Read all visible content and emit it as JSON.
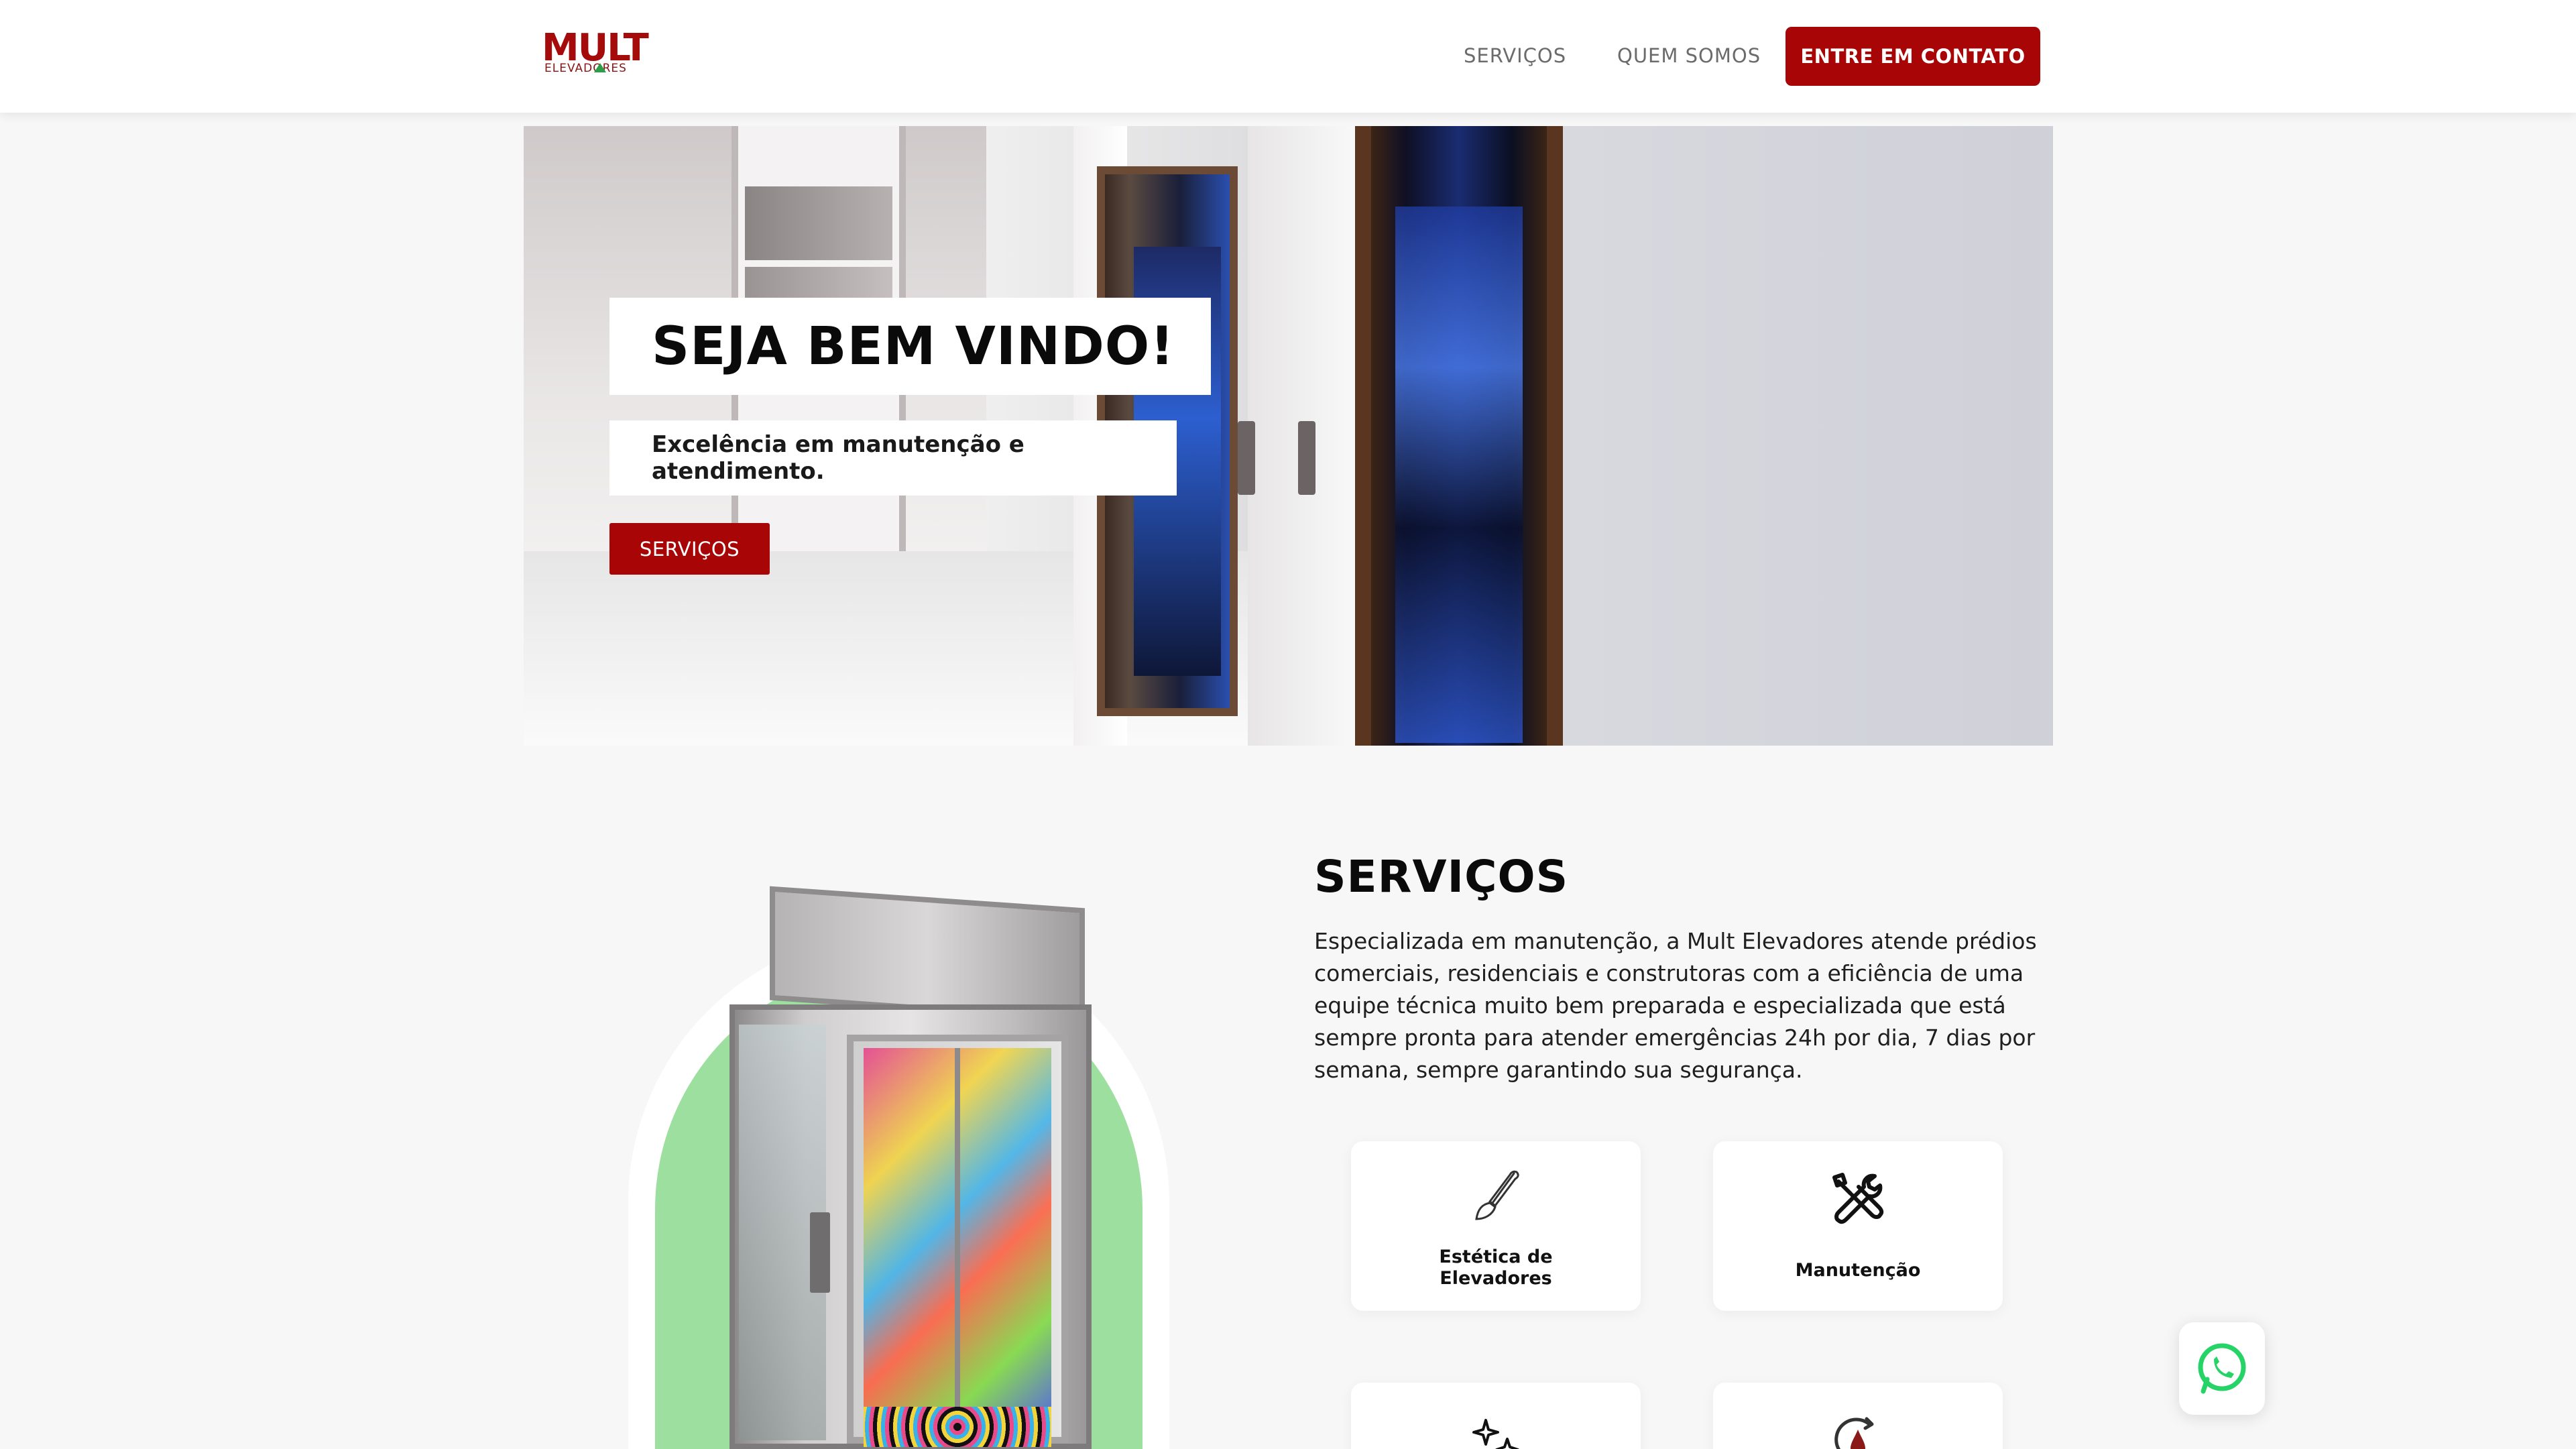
{
  "header": {
    "logo_text": "MULT",
    "logo_subtext": "ELEVADORES",
    "nav": {
      "services": "SERVIÇOS",
      "about": "QUEM SOMOS"
    },
    "cta_label": "ENTRE EM CONTATO"
  },
  "hero": {
    "title": "SEJA BEM VINDO!",
    "subtitle": "Excelência em manutenção e atendimento.",
    "button_label": "SERVIÇOS"
  },
  "services": {
    "title": "SERVIÇOS",
    "description": "Especializada em manutenção, a Mult Elevadores atende prédios comerciais, residenciais e construtoras com a eficiência de uma equipe técnica muito bem preparada e especializada que está sempre pronta para atender emergências 24h por dia, 7 dias por semana, sempre garantindo sua segurança.",
    "cards": [
      {
        "label_line1": "Estética de",
        "label_line2": "Elevadores",
        "icon": "brush-icon"
      },
      {
        "label": "Manutenção",
        "icon": "tools-icon"
      },
      {
        "icon": "sparkles-icon"
      },
      {
        "icon": "oil-drop-icon"
      }
    ]
  },
  "colors": {
    "brand_red": "#a80606",
    "accent_green": "#9ddf9e",
    "whatsapp_green": "#25d366"
  },
  "floating": {
    "icon": "whatsapp-icon"
  }
}
